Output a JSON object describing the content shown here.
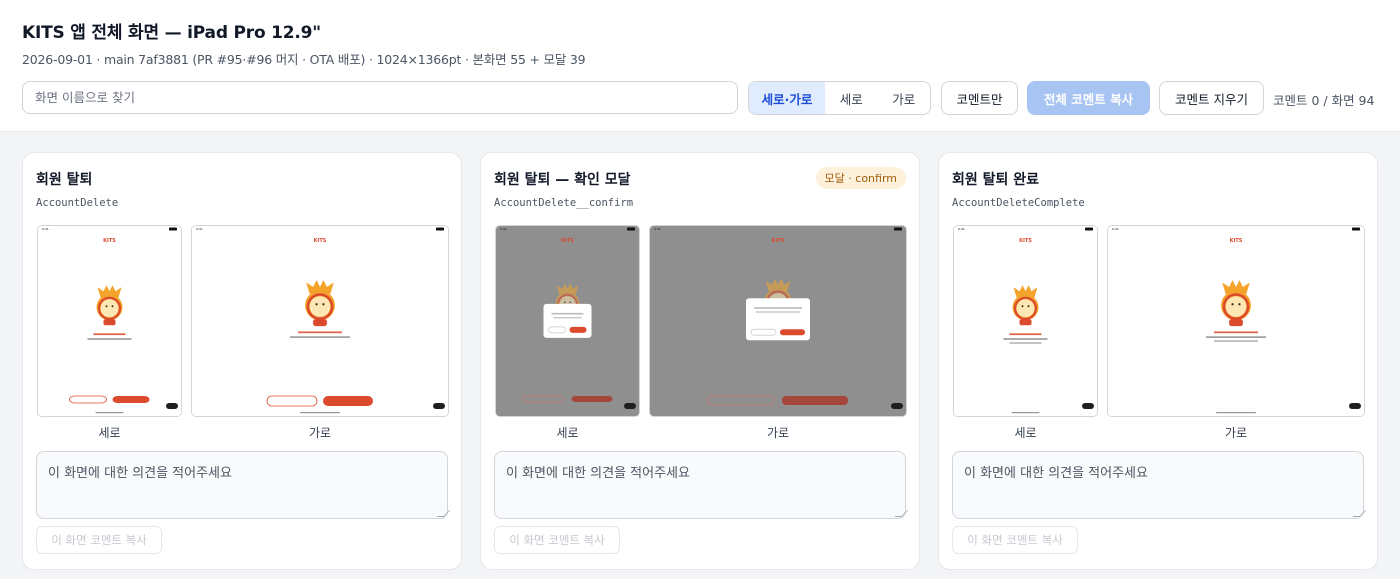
{
  "header": {
    "title": "KITS 앱 전체 화면 — iPad Pro 12.9\"",
    "meta": "2026-09-01 · main 7af3881 (PR #95·#96 머지 · OTA 배포) · 1024×1366pt · 본화면 55 + 모달 39"
  },
  "toolbar": {
    "search_placeholder": "화면 이름으로 찾기",
    "orientation_options": [
      "세로·가로",
      "세로",
      "가로"
    ],
    "orientation_selected": "세로·가로",
    "comments_only_label": "코멘트만",
    "copy_all_label": "전체 코멘트 복사",
    "clear_label": "코멘트 지우기",
    "count_text": "코멘트 0 / 화면 94"
  },
  "colors": {
    "accent": "#1d4ed8",
    "accent_bg": "#e0ecfd",
    "primary_button": "#a8c4f3",
    "brand_red": "#dc4a2e",
    "modal_badge_bg": "#fdf1dc",
    "modal_badge_text": "#a15c0b"
  },
  "cards": [
    {
      "title": "회원 탈퇴",
      "code": "AccountDelete",
      "badge": "",
      "shots": [
        {
          "label": "세로",
          "screen_text": "KITS",
          "dimmed": false
        },
        {
          "label": "가로",
          "screen_text": "KITS",
          "dimmed": false
        }
      ],
      "comment_placeholder": "이 화면에 대한 의견을 적어주세요",
      "copy_label": "이 화면 코멘트 복사"
    },
    {
      "title": "회원 탈퇴 — 확인 모달",
      "code": "AccountDelete__confirm",
      "badge": "모달 · confirm",
      "shots": [
        {
          "label": "세로",
          "screen_text": "KITS",
          "dimmed": true
        },
        {
          "label": "가로",
          "screen_text": "KITS",
          "dimmed": true
        }
      ],
      "comment_placeholder": "이 화면에 대한 의견을 적어주세요",
      "copy_label": "이 화면 코멘트 복사"
    },
    {
      "title": "회원 탈퇴 완료",
      "code": "AccountDeleteComplete",
      "badge": "",
      "shots": [
        {
          "label": "세로",
          "screen_text": "KITS",
          "dimmed": false
        },
        {
          "label": "가로",
          "screen_text": "KITS",
          "dimmed": false
        }
      ],
      "comment_placeholder": "이 화면에 대한 의견을 적어주세요",
      "copy_label": "이 화면 코멘트 복사"
    }
  ]
}
